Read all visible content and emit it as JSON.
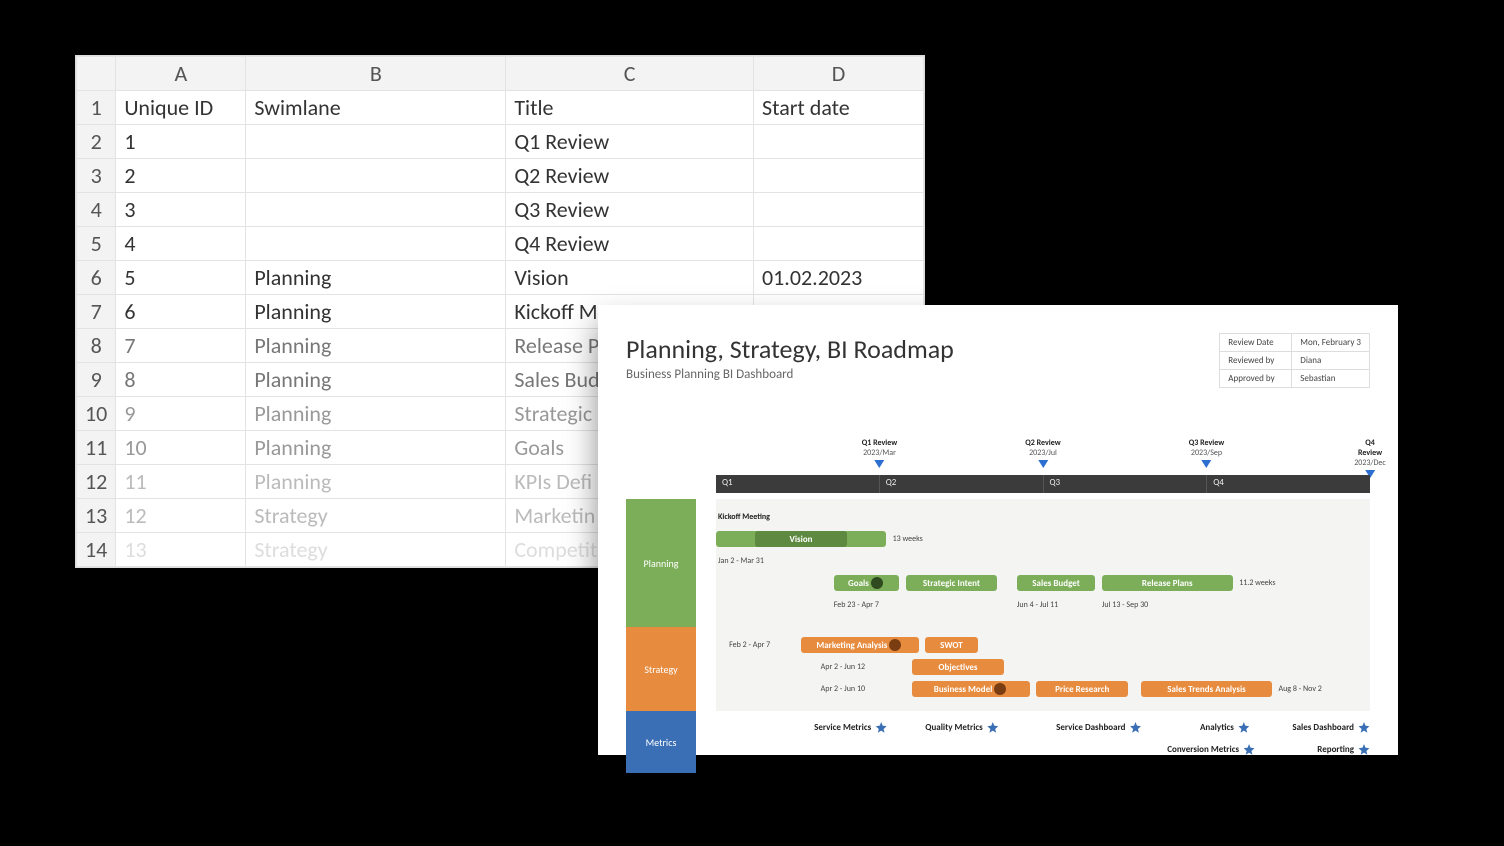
{
  "spreadsheet": {
    "columns": [
      "A",
      "B",
      "C",
      "D"
    ],
    "headers": {
      "A": "Unique ID",
      "B": "Swimlane",
      "C": "Title",
      "D": "Start date"
    },
    "rows": [
      {
        "n": "1",
        "A": "1",
        "B": "",
        "C": "Q1 Review",
        "D": ""
      },
      {
        "n": "2",
        "A": "2",
        "B": "",
        "C": "Q2 Review",
        "D": ""
      },
      {
        "n": "3",
        "A": "3",
        "B": "",
        "C": "Q3 Review",
        "D": ""
      },
      {
        "n": "4",
        "A": "4",
        "B": "",
        "C": "Q4 Review",
        "D": ""
      },
      {
        "n": "5",
        "A": "5",
        "B": "Planning",
        "C": "Vision",
        "D": "01.02.2023"
      },
      {
        "n": "6",
        "A": "6",
        "B": "Planning",
        "C": "Kickoff M",
        "D": ""
      },
      {
        "n": "7",
        "A": "7",
        "B": "Planning",
        "C": "Release P",
        "D": ""
      },
      {
        "n": "8",
        "A": "8",
        "B": "Planning",
        "C": "Sales Bud",
        "D": ""
      },
      {
        "n": "9",
        "A": "9",
        "B": "Planning",
        "C": "Strategic",
        "D": ""
      },
      {
        "n": "10",
        "A": "10",
        "B": "Planning",
        "C": "Goals",
        "D": ""
      },
      {
        "n": "11",
        "A": "11",
        "B": "Planning",
        "C": "KPIs Defi",
        "D": ""
      },
      {
        "n": "12",
        "A": "12",
        "B": "Strategy",
        "C": "Marketin",
        "D": ""
      },
      {
        "n": "13",
        "A": "13",
        "B": "Strategy",
        "C": "Competit",
        "D": ""
      }
    ]
  },
  "roadmap": {
    "title": "Planning, Strategy, BI Roadmap",
    "subtitle": "Business Planning BI Dashboard",
    "meta": {
      "review_date_label": "Review Date",
      "review_date": "Mon, February 3",
      "reviewed_by_label": "Reviewed by",
      "reviewed_by": "Diana",
      "approved_by_label": "Approved by",
      "approved_by": "Sebastian"
    },
    "milestones": [
      {
        "label": "Q1 Review",
        "date": "2023/Mar",
        "pct": 25
      },
      {
        "label": "Q2 Review",
        "date": "2023/Jul",
        "pct": 50
      },
      {
        "label": "Q3 Review",
        "date": "2023/Sep",
        "pct": 75
      },
      {
        "label": "Q4 Review",
        "date": "2023/Dec",
        "pct": 100
      }
    ],
    "quarters": [
      "Q1",
      "Q2",
      "Q3",
      "Q4"
    ],
    "lanes": {
      "planning": {
        "label": "Planning",
        "kickoff_label": "Kickoff Meeting",
        "vision": "Vision",
        "vision_range": "Jan 2 - Mar 31",
        "vision_len": "13 weeks",
        "goals": "Goals",
        "goals_range": "Feb 23 - Apr 7",
        "intent": "Strategic Intent",
        "budget": "Sales Budget",
        "budget_range": "Jun 4 - Jul 11",
        "release": "Release Plans",
        "release_range": "Jul 13 - Sep 30",
        "release_len": "11.2 weeks"
      },
      "strategy": {
        "label": "Strategy",
        "mkt_range": "Feb 2 - Apr 7",
        "mkt": "Marketing Analysis",
        "swot": "SWOT",
        "obj_range": "Apr 2 - Jun 12",
        "obj": "Objectives",
        "bm_range": "Apr 2 - Jun 10",
        "bm": "Business Model",
        "price": "Price Research",
        "trends": "Sales Trends Analysis",
        "trends_range": "Aug 8 - Nov 2"
      },
      "metrics": {
        "label": "Metrics",
        "items_row1": [
          "Service Metrics",
          "Quality Metrics",
          "Service Dashboard",
          "Analytics",
          "Sales Dashboard"
        ],
        "items_row2": [
          "Conversion Metrics",
          "Reporting"
        ]
      }
    }
  }
}
